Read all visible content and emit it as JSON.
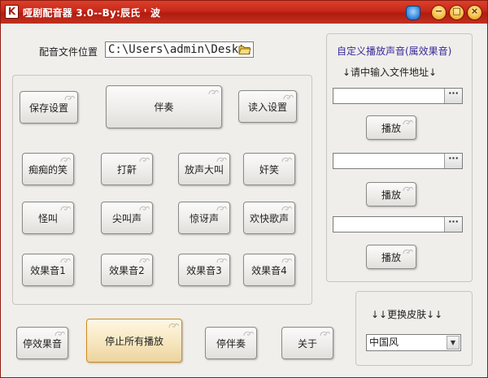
{
  "window": {
    "title": "哑剧配音器 3.0--By:辰氏 ' 波",
    "app_icon_letter": "K",
    "minimize": "−",
    "maximize": "□",
    "close": "×"
  },
  "path": {
    "label": "配音文件位置",
    "value": "C:\\Users\\admin\\Deskt"
  },
  "top_buttons": {
    "save": "保存设置",
    "accompany": "伴奏",
    "load": "读入设置"
  },
  "effects": [
    "痴痴的笑",
    "打鼾",
    "放声大叫",
    "奸笑",
    "怪叫",
    "尖叫声",
    "惊讶声",
    "欢快歌声",
    "效果音1",
    "效果音2",
    "效果音3",
    "效果音4"
  ],
  "bottom_buttons": {
    "stop_effects": "停效果音",
    "stop_all": "停止所有播放",
    "stop_accompany": "停伴奏",
    "about": "关于"
  },
  "custom": {
    "title": "自定义播放声音(属效果音)",
    "hint": "↓请中输入文件地址↓",
    "inputs": [
      "",
      "",
      ""
    ],
    "browse_label": "···",
    "play_labels": [
      "播放",
      "播放",
      "播放"
    ]
  },
  "skin": {
    "title": "↓↓更换皮肤↓↓",
    "selected": "中国风",
    "arrow": "▼"
  },
  "colors": {
    "title_bar": "#c8271a",
    "accent_purple": "#3a2a9a",
    "highlight_button": "#f6e6bf"
  }
}
